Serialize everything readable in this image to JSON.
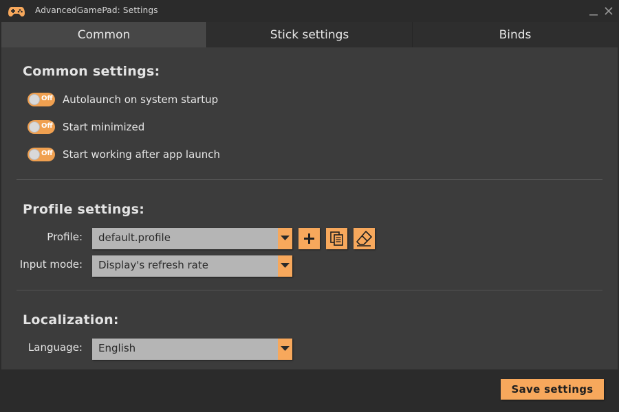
{
  "window": {
    "title": "AdvancedGamePad: Settings",
    "icon": "gamepad-icon",
    "accent_color": "#f7a85c"
  },
  "tabs": [
    {
      "label": "Common",
      "active": true
    },
    {
      "label": "Stick settings",
      "active": false
    },
    {
      "label": "Binds",
      "active": false
    }
  ],
  "common": {
    "title": "Common settings:",
    "toggles": [
      {
        "label": "Autolaunch on system startup",
        "state": "Off"
      },
      {
        "label": "Start minimized",
        "state": "Off"
      },
      {
        "label": "Start working after app launch",
        "state": "Off"
      }
    ]
  },
  "profile": {
    "title": "Profile settings:",
    "profile_label": "Profile:",
    "profile_value": "default.profile",
    "input_mode_label": "Input mode:",
    "input_mode_value": "Display's refresh rate",
    "buttons": [
      "plus-icon",
      "copy-icon",
      "eraser-icon"
    ]
  },
  "localization": {
    "title": "Localization:",
    "language_label": "Language:",
    "language_value": "English"
  },
  "footer": {
    "save_label": "Save settings"
  }
}
